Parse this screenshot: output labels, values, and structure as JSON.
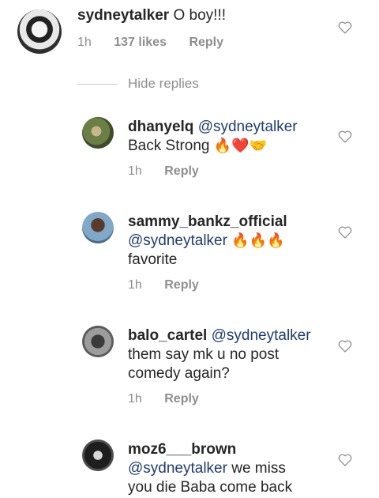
{
  "main_comment": {
    "username": "sydneytalker",
    "text": "O boy!!!",
    "time": "1h",
    "likes": "137 likes",
    "reply_label": "Reply",
    "like_icon": "heart-outline-icon"
  },
  "hide_replies_label": "Hide replies",
  "replies": [
    {
      "username": "dhanyelq",
      "mention": "@sydneytalker",
      "text_line1_after": "",
      "text_line2": "Back Strong",
      "emojis": "🔥❤️🤝",
      "time": "1h",
      "reply_label": "Reply"
    },
    {
      "username": "sammy_bankz_official",
      "mention": "@sydneytalker",
      "emojis": "🔥🔥🔥",
      "text_line3": "favorite",
      "time": "1h",
      "reply_label": "Reply"
    },
    {
      "username": "balo_cartel",
      "mention": "@sydneytalker",
      "text_line2": "them say mk u no post",
      "text_line3": "comedy again?",
      "time": "1h",
      "reply_label": "Reply"
    },
    {
      "username": "moz6___brown",
      "mention": "@sydneytalker",
      "text_line2_after": " we miss",
      "text_line3": "you die Baba come back"
    }
  ]
}
